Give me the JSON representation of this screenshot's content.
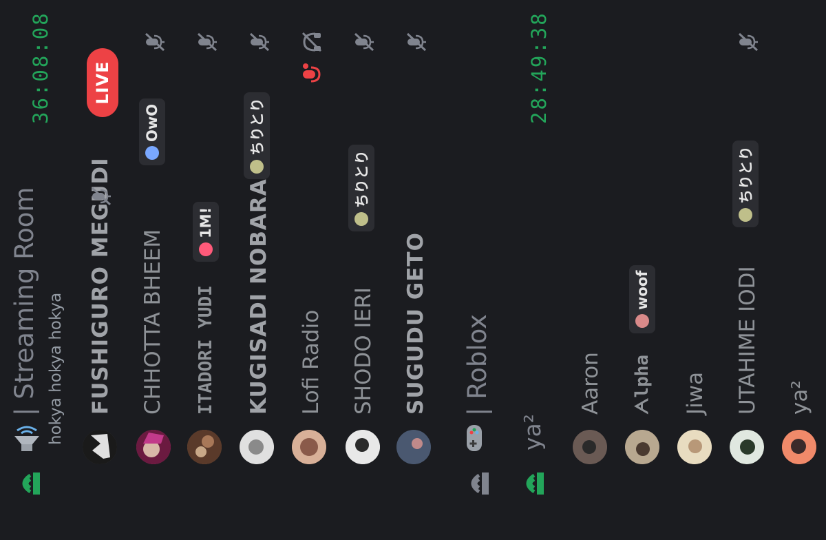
{
  "channels": [
    {
      "name": "Streaming Room",
      "separator": "|",
      "topic": "hokya hokya hokya",
      "timer": "36:08:08",
      "icon": "speaker-sound-icon",
      "users": [
        {
          "name": "FUSHIGURO MEGUDI",
          "avatar_color": "#3a3a3a",
          "live": "LIVE",
          "muted": true
        },
        {
          "name": "CHHOTTA BHEEM",
          "avatar_color": "#b0306c",
          "tag": {
            "icon_color": "#7aa8ff",
            "text": "OwO"
          },
          "muted": true
        },
        {
          "name": "ITADORI YUDI",
          "avatar_color": "#8a5a3a",
          "tag": {
            "icon_color": "#ff5a7a",
            "text": "1M!"
          },
          "muted": true
        },
        {
          "name": "KUGISADI NOBARA",
          "avatar_color": "#b7b7b7",
          "tag": {
            "icon_color": "#bfbf8a",
            "text": "ちりとり"
          },
          "muted": true
        },
        {
          "name": "Lofi Radio",
          "avatar_color": "#c08a6a",
          "deafened": true,
          "speaking_icon": "mic-speaking-icon"
        },
        {
          "name": "SHODO IERI",
          "avatar_color": "#e0e0e0",
          "tag": {
            "icon_color": "#bfbf8a",
            "text": "ちりとり"
          },
          "muted": true
        },
        {
          "name": "SUGUDU GETO",
          "avatar_color": "#3b4a5e",
          "muted": true
        }
      ]
    },
    {
      "name": "Roblox",
      "separator": "|",
      "icon": "gamepad-icon",
      "users": []
    },
    {
      "name": "ya²",
      "separator": "",
      "timer": "28:49:38",
      "icon": "voice-channel-icon",
      "users": [
        {
          "name": "Aaron",
          "avatar_color": "#5a4a44"
        },
        {
          "name": "ᗅlpha",
          "avatar_color": "#8a7a6a",
          "tag": {
            "icon_color": "#d98a8a",
            "text": "woof"
          }
        },
        {
          "name": "Jiwa",
          "avatar_color": "#d8c8a8"
        },
        {
          "name": "UTAHIME IODI",
          "avatar_color": "#2a3a2a",
          "tag": {
            "icon_color": "#bfbf8a",
            "text": "ちりとり"
          },
          "muted": true
        },
        {
          "name": "ya²",
          "avatar_color": "#e06a4a"
        }
      ]
    }
  ],
  "colors": {
    "background": "#1b1c20",
    "timer": "#23a55a",
    "live": "#ed4245",
    "voice_active": "#23a55a",
    "voice_idle": "#80848e"
  }
}
